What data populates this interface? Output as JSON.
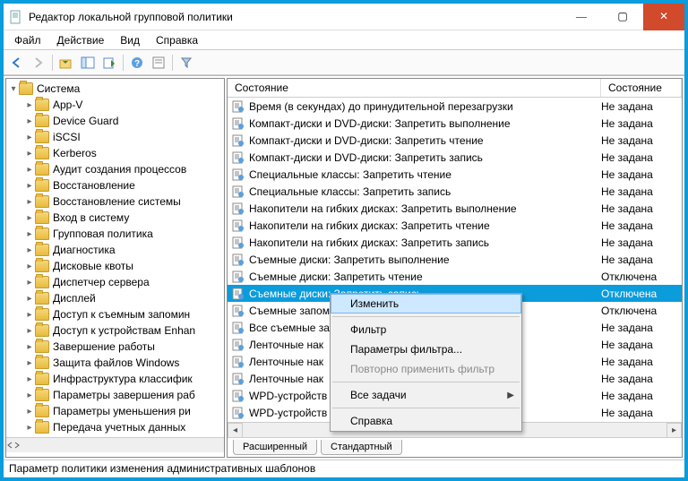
{
  "window": {
    "title": "Редактор локальной групповой политики"
  },
  "titlebar": {
    "min": "—",
    "max": "▢",
    "close": "✕"
  },
  "menubar": [
    "Файл",
    "Действие",
    "Вид",
    "Справка"
  ],
  "tree": {
    "root": "Система",
    "items": [
      "App-V",
      "Device Guard",
      "iSCSI",
      "Kerberos",
      "Аудит создания процессов",
      "Восстановление",
      "Восстановление системы",
      "Вход в систему",
      "Групповая политика",
      "Диагностика",
      "Дисковые квоты",
      "Диспетчер сервера",
      "Дисплей",
      "Доступ к съемным запомин",
      "Доступ к устройствам Enhan",
      "Завершение работы",
      "Защита файлов Windows",
      "Инфраструктура классифик",
      "Параметры завершения раб",
      "Параметры уменьшения ри",
      "Передача учетных данных"
    ]
  },
  "list": {
    "columns": {
      "name": "Состояние",
      "state": "Состояние"
    },
    "rows": [
      {
        "name": "Время (в секундах) до принудительной перезагрузки",
        "state": "Не задана",
        "sel": false
      },
      {
        "name": "Компакт-диски и DVD-диски: Запретить выполнение",
        "state": "Не задана",
        "sel": false
      },
      {
        "name": "Компакт-диски и DVD-диски: Запретить чтение",
        "state": "Не задана",
        "sel": false
      },
      {
        "name": "Компакт-диски и DVD-диски: Запретить запись",
        "state": "Не задана",
        "sel": false
      },
      {
        "name": "Специальные классы: Запретить чтение",
        "state": "Не задана",
        "sel": false
      },
      {
        "name": "Специальные классы: Запретить запись",
        "state": "Не задана",
        "sel": false
      },
      {
        "name": "Накопители на гибких дисках: Запретить выполнение",
        "state": "Не задана",
        "sel": false
      },
      {
        "name": "Накопители на гибких дисках: Запретить чтение",
        "state": "Не задана",
        "sel": false
      },
      {
        "name": "Накопители на гибких дисках: Запретить запись",
        "state": "Не задана",
        "sel": false
      },
      {
        "name": "Съемные диски: Запретить выполнение",
        "state": "Не задана",
        "sel": false
      },
      {
        "name": "Съемные диски: Запретить чтение",
        "state": "Отключена",
        "sel": false
      },
      {
        "name": "Съемные диски: Запретить запись",
        "state": "Отключена",
        "sel": true
      },
      {
        "name": "Съемные запом",
        "state": "Отключена",
        "sel": false
      },
      {
        "name": "Все съемные зап",
        "state": "Не задана",
        "sel": false
      },
      {
        "name": "Ленточные нак",
        "state": "Не задана",
        "sel": false
      },
      {
        "name": "Ленточные нак",
        "state": "Не задана",
        "sel": false
      },
      {
        "name": "Ленточные нак",
        "state": "Не задана",
        "sel": false
      },
      {
        "name": "WPD-устройств",
        "state": "Не задана",
        "sel": false
      },
      {
        "name": "WPD-устройств",
        "state": "Не задана",
        "sel": false
      }
    ]
  },
  "context_menu": [
    {
      "label": "Изменить",
      "state": "highlight"
    },
    {
      "label": "Фильтр",
      "state": "normal"
    },
    {
      "label": "Параметры фильтра...",
      "state": "normal"
    },
    {
      "label": "Повторно применить фильтр",
      "state": "disabled"
    },
    {
      "label": "Все задачи",
      "state": "sub"
    },
    {
      "label": "Справка",
      "state": "normal"
    }
  ],
  "tabs": {
    "extended": "Расширенный",
    "standard": "Стандартный"
  },
  "statusbar": "Параметр политики изменения административных шаблонов"
}
